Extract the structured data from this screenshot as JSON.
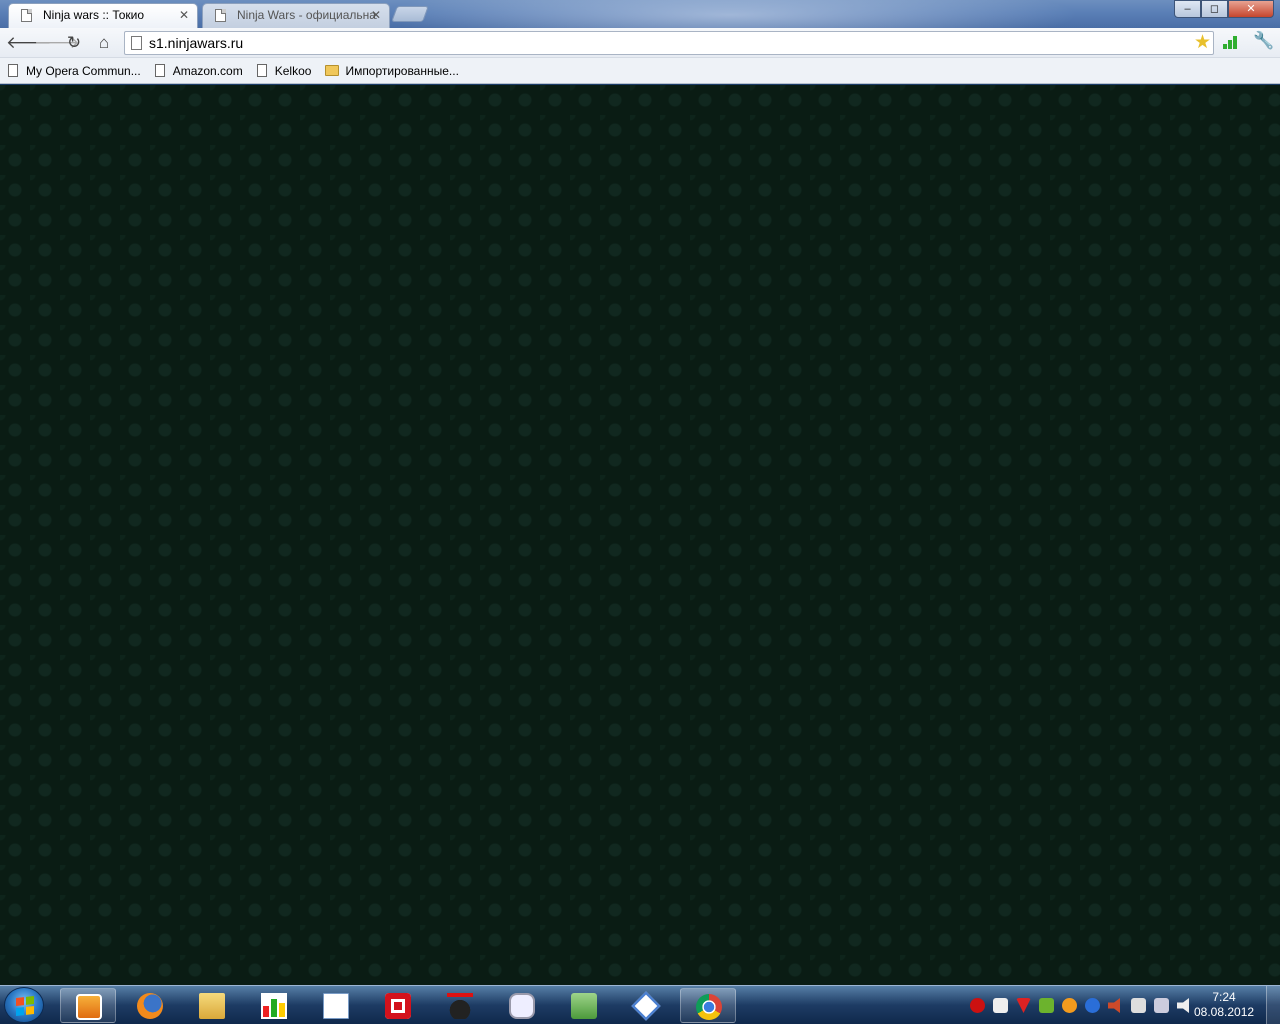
{
  "browser": {
    "tabs": [
      {
        "label": "Ninja wars :: Токио",
        "active": true
      },
      {
        "label": "Ninja Wars - официальная",
        "active": false
      }
    ],
    "address": "s1.ninjawars.ru",
    "window_controls": {
      "minimize": "–",
      "maximize": "◻",
      "close": "✕"
    }
  },
  "bookmarks": [
    {
      "label": "My Opera Commun...",
      "icon": "page-icon"
    },
    {
      "label": "Amazon.com",
      "icon": "page-icon"
    },
    {
      "label": "Kelkoo",
      "icon": "page-icon"
    },
    {
      "label": "Импортированные...",
      "icon": "folder-icon"
    }
  ],
  "page": {
    "background": "#0a1c14"
  },
  "taskbar": {
    "apps": [
      "media-player-icon",
      "firefox-icon",
      "file-explorer-icon",
      "charts-app-icon",
      "document-icon",
      "opera-icon",
      "game-mask-icon",
      "gamepad-icon",
      "money-app-icon",
      "network-app-icon",
      "chrome-icon"
    ],
    "clock": {
      "time": "7:24",
      "date": "08.08.2012"
    }
  }
}
